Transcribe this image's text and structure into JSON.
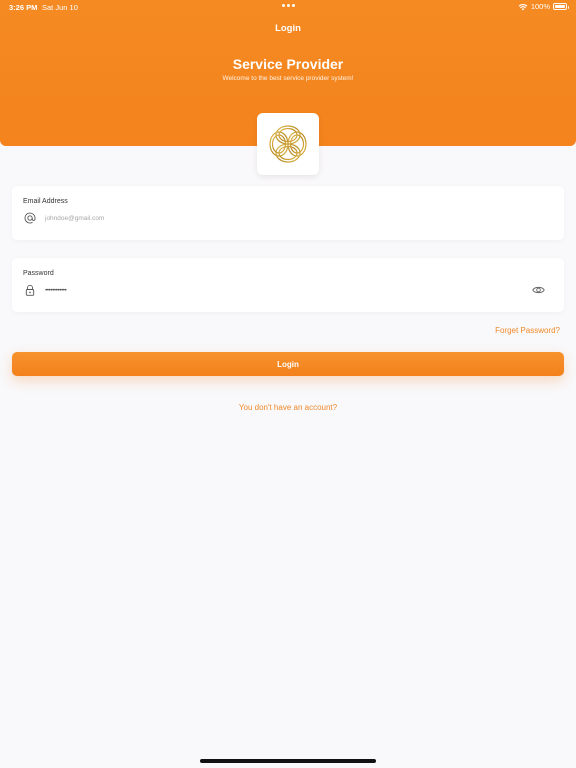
{
  "status_bar": {
    "time": "3:26 PM",
    "date": "Sat Jun 10",
    "battery": "100%"
  },
  "header": {
    "nav_title": "Login",
    "title": "Service Provider",
    "subtitle": "Welcome to the best service provider system!"
  },
  "form": {
    "email": {
      "label": "Email Address",
      "placeholder": "johndoe@gmail.com",
      "icon": "at-icon"
    },
    "password": {
      "label": "Password",
      "value": "••••••••••••",
      "icon": "lock-icon",
      "toggle_icon": "eye-icon"
    },
    "forgot_label": "Forget Password?",
    "login_label": "Login",
    "signup_label": "You don't have an account?"
  },
  "colors": {
    "accent": "#f4831d",
    "link": "#ef8a2b",
    "logo_gold": "#c9a13b"
  }
}
